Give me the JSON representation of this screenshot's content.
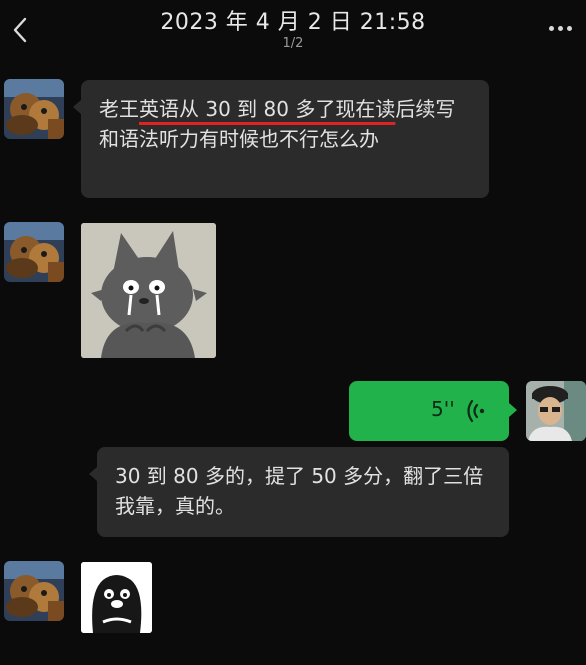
{
  "header": {
    "title": "2023 年 4 月 2 日 21:58",
    "page_indicator": "1/2"
  },
  "messages": [
    {
      "type": "text",
      "sender": "other",
      "text_parts": [
        "老王",
        "英语从 30 到 80 多了现在读",
        "后续写和语法听力有时候也不行怎么办"
      ]
    },
    {
      "type": "sticker",
      "sender": "other",
      "icon": "crying-wolf-sticker"
    },
    {
      "type": "voice",
      "sender": "self",
      "duration": "5''",
      "icon": "voice-wave-icon"
    },
    {
      "type": "text",
      "sender": "self",
      "text": "30 到 80 多的，提了 50 多分，翻了三倍我靠，真的。"
    },
    {
      "type": "sticker",
      "sender": "other",
      "icon": "penguin-sticker"
    }
  ],
  "colors": {
    "background": "#0b0b0b",
    "bubble_gray": "#2b2b2b",
    "bubble_green": "#22b24c",
    "highlight_underline": "#e02222"
  }
}
